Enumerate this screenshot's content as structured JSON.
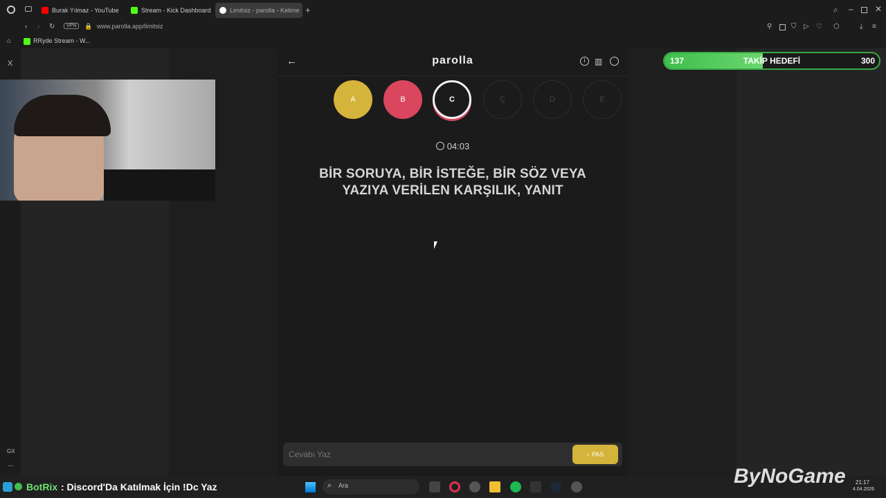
{
  "browser": {
    "tabs": [
      {
        "label": "Burak Yılmaz - YouTube",
        "color": "#ff0000"
      },
      {
        "label": "Stream - Kick Dashboard",
        "color": "#53fc18"
      },
      {
        "label": "Limitsiz - parolla - Kelime",
        "color": "#ffffff"
      }
    ],
    "url": "www.parolla.app/limitsiz",
    "vpn_label": "VPN",
    "bookmark": "RRyde Stream - W..."
  },
  "rail": {
    "x_label": "X",
    "gx_label": "GX",
    "more_label": "..."
  },
  "game": {
    "title": "parolla",
    "letters": [
      {
        "label": "A",
        "state": "correct",
        "color": "#d4b43a"
      },
      {
        "label": "B",
        "state": "wrong",
        "color": "#d9465e"
      },
      {
        "label": "C",
        "state": "current",
        "color": "#1b1b1b"
      },
      {
        "label": "Ç",
        "state": "pending",
        "color": "#1b1b1b"
      },
      {
        "label": "D",
        "state": "pending",
        "color": "#1b1b1b"
      },
      {
        "label": "E",
        "state": "pending",
        "color": "#1b1b1b"
      }
    ],
    "timer": "04:03",
    "question_line1": "BİR SORUYA, BİR İSTEĞE, BİR SÖZ VEYA",
    "question_line2": "YAZIYA VERİLEN KARŞILIK, YANIT",
    "answer_placeholder": "Cevabı Yaz",
    "pass_label": "PAS"
  },
  "goal": {
    "current": "137",
    "label": "TAKİP HEDEFİ",
    "target": "300",
    "progress": 0.4567
  },
  "overlay": {
    "bot_name": "BotRix",
    "bot_message": ": Discord'Da Katılmak İçin !Dc Yaz",
    "watermark": "ByNoGame"
  },
  "taskbar": {
    "search_label": "Ara",
    "time": "21:17",
    "date": "4.04.2026"
  }
}
